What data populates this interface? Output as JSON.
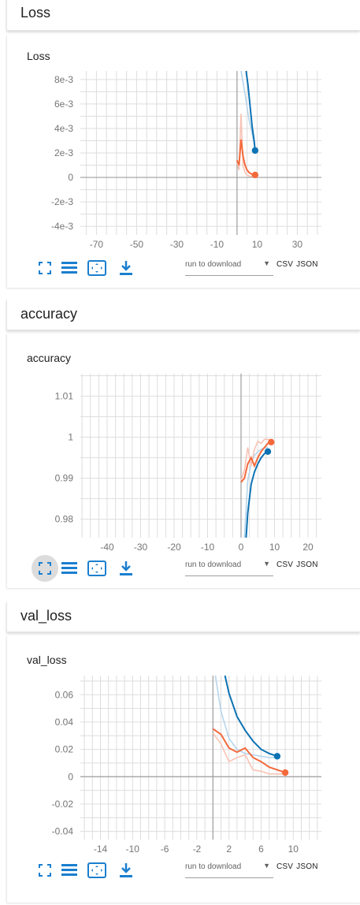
{
  "colors": {
    "orange": "#f4693c",
    "blue": "#0c72b3",
    "orange_light": "#f8c3b5",
    "blue_light": "#b6d5eb",
    "grid": "#dddddd",
    "axis_zero": "#9e9e9e"
  },
  "toolbar": {
    "icons": [
      "fit-screen-icon",
      "list-icon",
      "zoom-fit-icon",
      "download-icon"
    ],
    "download_select": "run to download",
    "csv_label": "CSV",
    "json_label": "JSON"
  },
  "panels": [
    {
      "header": "Loss",
      "card_title": "Loss",
      "toolbar_active": null,
      "chart_data": {
        "type": "line",
        "title": "Loss",
        "xlim": [
          -78,
          42
        ],
        "ylim": [
          -0.0047,
          0.0087
        ],
        "x_ticks": [
          -70,
          -50,
          -30,
          -10,
          10,
          30
        ],
        "x_tick_labels": [
          "-70",
          "-50",
          "-30",
          "-10",
          "10",
          "30"
        ],
        "y_ticks": [
          0.008,
          0.006,
          0.004,
          0.002,
          0,
          -0.002,
          -0.004
        ],
        "y_tick_labels": [
          "8e-3",
          "6e-3",
          "4e-3",
          "2e-3",
          "0",
          "-2e-3",
          "-4e-3"
        ],
        "grid": true,
        "series": [
          {
            "color": "blue",
            "raw": [
              [
                2,
                0.0087
              ],
              [
                4,
                0.0068
              ],
              [
                6,
                0.0047
              ],
              [
                8,
                0.0032
              ],
              [
                9,
                0.0023
              ]
            ],
            "values": [
              [
                4.5,
                0.0087
              ],
              [
                5.5,
                0.0075
              ],
              [
                6.5,
                0.0058
              ],
              [
                7.5,
                0.0042
              ],
              [
                8.5,
                0.003
              ],
              [
                9,
                0.0022
              ]
            ]
          },
          {
            "color": "orange",
            "raw": [
              [
                0,
                0.0012
              ],
              [
                1,
                0.0006
              ],
              [
                2,
                0.0052
              ],
              [
                3,
                0.0009
              ],
              [
                4,
                0.0004
              ],
              [
                5,
                0.0002
              ],
              [
                6,
                0.0001
              ],
              [
                7,
                0.0001
              ],
              [
                8,
                0.0001
              ],
              [
                9,
                0.0001
              ]
            ],
            "values": [
              [
                0,
                0.0014
              ],
              [
                1,
                0.001
              ],
              [
                2,
                0.0031
              ],
              [
                3,
                0.0017
              ],
              [
                4,
                0.001
              ],
              [
                5,
                0.0006
              ],
              [
                6,
                0.0004
              ],
              [
                7,
                0.0003
              ],
              [
                8,
                0.0002
              ],
              [
                9,
                0.0002
              ]
            ]
          }
        ]
      }
    },
    {
      "header": "accuracy",
      "card_title": "accuracy",
      "toolbar_active": 0,
      "chart_data": {
        "type": "line",
        "title": "accuracy",
        "xlim": [
          -48,
          24
        ],
        "ylim": [
          0.9755,
          1.0155
        ],
        "x_ticks": [
          -40,
          -30,
          -20,
          -10,
          0,
          10,
          20
        ],
        "x_tick_labels": [
          "-40",
          "-30",
          "-20",
          "-10",
          "0",
          "10",
          "20"
        ],
        "y_ticks": [
          1.01,
          1.0,
          0.99,
          0.98
        ],
        "y_tick_labels": [
          "1.01",
          "1",
          "0.99",
          "0.98"
        ],
        "grid": true,
        "series": [
          {
            "color": "blue",
            "raw": [
              [
                1,
                0.9755
              ],
              [
                2,
                0.9895
              ],
              [
                3,
                0.9935
              ],
              [
                4,
                0.9955
              ],
              [
                5,
                0.9965
              ],
              [
                6,
                0.997
              ],
              [
                7,
                0.9975
              ],
              [
                8,
                0.9975
              ]
            ],
            "values": [
              [
                1.5,
                0.9755
              ],
              [
                2,
                0.9815
              ],
              [
                3,
                0.9885
              ],
              [
                4,
                0.9915
              ],
              [
                5,
                0.9935
              ],
              [
                6,
                0.995
              ],
              [
                7,
                0.996
              ],
              [
                8,
                0.9965
              ]
            ]
          },
          {
            "color": "orange",
            "raw": [
              [
                0,
                0.9895
              ],
              [
                1,
                0.992
              ],
              [
                2,
                0.9975
              ],
              [
                3,
                0.993
              ],
              [
                4,
                0.997
              ],
              [
                5,
                0.999
              ],
              [
                6,
                0.9985
              ],
              [
                7,
                0.9995
              ],
              [
                8,
                0.9995
              ],
              [
                9,
                0.999
              ]
            ],
            "values": [
              [
                0,
                0.989
              ],
              [
                1,
                0.99
              ],
              [
                2,
                0.9935
              ],
              [
                3,
                0.995
              ],
              [
                4,
                0.993
              ],
              [
                5,
                0.995
              ],
              [
                6,
                0.9965
              ],
              [
                7,
                0.9975
              ],
              [
                8,
                0.9985
              ],
              [
                9,
                0.9988
              ]
            ]
          }
        ]
      }
    },
    {
      "header": "val_loss",
      "card_title": "val_loss",
      "toolbar_active": null,
      "chart_data": {
        "type": "line",
        "title": "val_loss",
        "xlim": [
          -16.5,
          13.5
        ],
        "ylim": [
          -0.046,
          0.074
        ],
        "x_ticks": [
          -14,
          -10,
          -6,
          -2,
          2,
          6,
          10
        ],
        "x_tick_labels": [
          "-14",
          "-10",
          "-6",
          "-2",
          "2",
          "6",
          "10"
        ],
        "y_ticks": [
          0.06,
          0.04,
          0.02,
          0,
          -0.02,
          -0.04
        ],
        "y_tick_labels": [
          "0.06",
          "0.04",
          "0.02",
          "0",
          "-0.02",
          "-0.04"
        ],
        "grid": true,
        "series": [
          {
            "color": "blue",
            "raw": [
              [
                0.3,
                0.074
              ],
              [
                1,
                0.048
              ],
              [
                2,
                0.028
              ],
              [
                3,
                0.02
              ],
              [
                4,
                0.017
              ],
              [
                5,
                0.016
              ],
              [
                6,
                0.015
              ],
              [
                7,
                0.014
              ],
              [
                8,
                0.014
              ]
            ],
            "values": [
              [
                1.5,
                0.074
              ],
              [
                2,
                0.061
              ],
              [
                3,
                0.044
              ],
              [
                4,
                0.034
              ],
              [
                5,
                0.026
              ],
              [
                6,
                0.02
              ],
              [
                7,
                0.017
              ],
              [
                8,
                0.015
              ]
            ]
          },
          {
            "color": "orange",
            "raw": [
              [
                0,
                0.032
              ],
              [
                1,
                0.024
              ],
              [
                2,
                0.011
              ],
              [
                3,
                0.014
              ],
              [
                4,
                0.016
              ],
              [
                5,
                0.005
              ],
              [
                6,
                0.004
              ],
              [
                7,
                0.002
              ],
              [
                8,
                0.002
              ],
              [
                9,
                0.002
              ]
            ],
            "values": [
              [
                0,
                0.035
              ],
              [
                1,
                0.031
              ],
              [
                2,
                0.021
              ],
              [
                3,
                0.018
              ],
              [
                4,
                0.021
              ],
              [
                5,
                0.014
              ],
              [
                6,
                0.011
              ],
              [
                7,
                0.007
              ],
              [
                8,
                0.005
              ],
              [
                9,
                0.003
              ]
            ]
          }
        ]
      }
    }
  ]
}
